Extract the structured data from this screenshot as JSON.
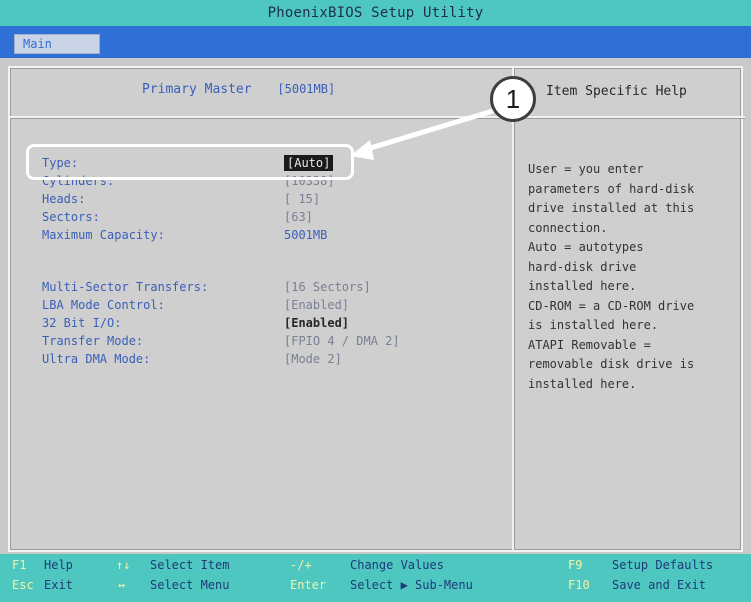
{
  "title": "PhoenixBIOS Setup Utility",
  "menu": {
    "tab_main": "Main"
  },
  "header": {
    "primary_label": "Primary Master",
    "primary_value": "[5001MB]"
  },
  "help": {
    "title": "Item Specific Help",
    "lines": [
      "User = you enter",
      "parameters of hard-disk",
      "drive installed at this",
      "connection.",
      "Auto = autotypes",
      "hard-disk drive",
      "installed here.",
      "CD-ROM = a CD-ROM drive",
      "is installed here.",
      "ATAPI Removable =",
      "removable disk drive is",
      "installed here."
    ]
  },
  "fields": {
    "type": {
      "label": "Type:",
      "value": "[Auto]"
    },
    "cylinders": {
      "label": "Cylinders:",
      "value": "[10338]"
    },
    "heads": {
      "label": "Heads:",
      "value": "[ 15]"
    },
    "sectors": {
      "label": "Sectors:",
      "value": "[63]"
    },
    "max_capacity": {
      "label": "Maximum Capacity:",
      "value": "5001MB"
    },
    "multi_sector": {
      "label": "Multi-Sector Transfers:",
      "value": "[16 Sectors]"
    },
    "lba_mode": {
      "label": "LBA Mode Control:",
      "value": "[Enabled]"
    },
    "bit32_io": {
      "label": "32 Bit I/O:",
      "value": "[Enabled]"
    },
    "transfer_mode": {
      "label": "Transfer Mode:",
      "value": "[FPIO 4 / DMA 2]"
    },
    "ultra_dma": {
      "label": "Ultra DMA Mode:",
      "value": "[Mode 2]"
    }
  },
  "callout": {
    "number": "1"
  },
  "footer": {
    "f1_key": "F1",
    "f1_label": "Help",
    "updown_key": "↑↓",
    "updown_label": "Select Item",
    "plusminus_key": "-/+",
    "plusminus_label": "Change Values",
    "f9_key": "F9",
    "f9_label": "Setup Defaults",
    "esc_key": "Esc",
    "esc_label": "Exit",
    "leftright_key": "↔",
    "leftright_label": "Select Menu",
    "enter_key": "Enter",
    "enter_label": "Select ▶ Sub-Menu",
    "f10_key": "F10",
    "f10_label": "Save and Exit"
  },
  "colors": {
    "title_bar": "#4fc7c1",
    "menu_bar": "#2f6fd6",
    "label_blue": "#3a5fb9",
    "panel": "#cfcfcf"
  }
}
